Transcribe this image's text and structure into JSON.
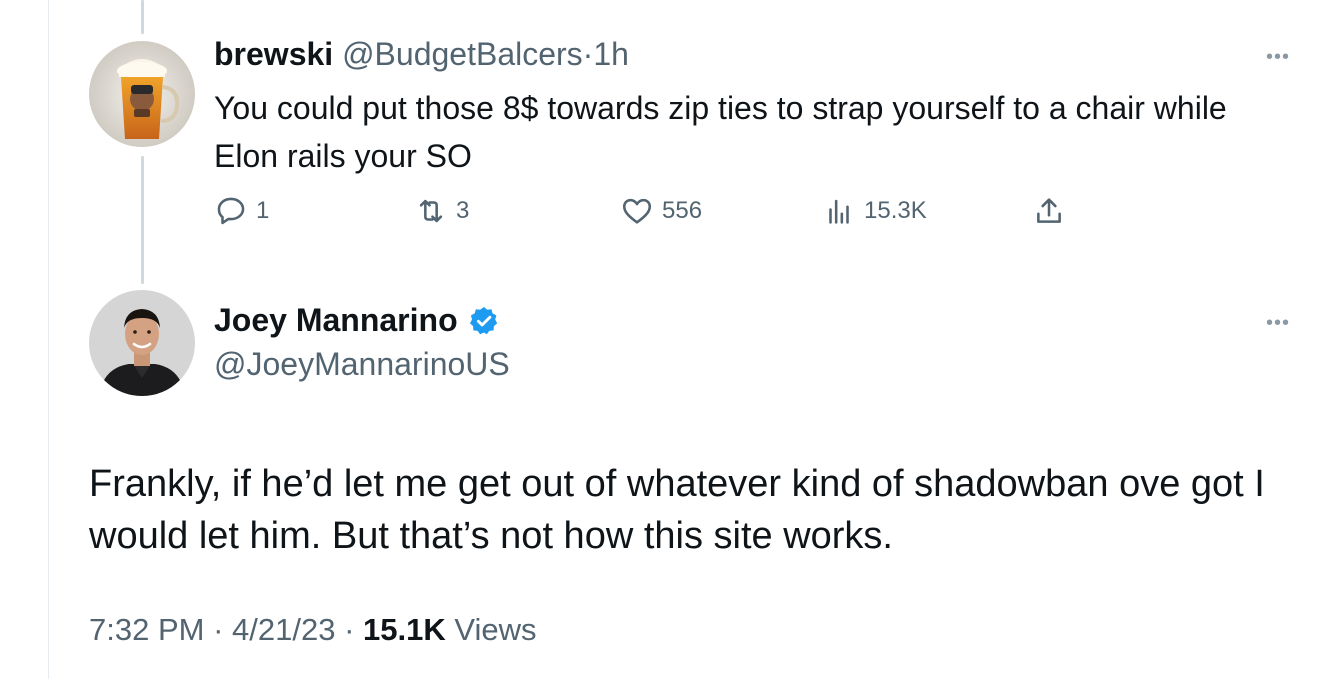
{
  "reply_tweet": {
    "display_name": "brewski",
    "handle": "@BudgetBalcers",
    "separator": "·",
    "time_ago": "1h",
    "text": "You could put those 8$ towards zip ties to strap yourself to a chair while Elon rails your SO",
    "avatar_icon": "beer-mug-avatar",
    "more_icon": "more-horizontal-icon",
    "actions": {
      "replies": "1",
      "retweets": "3",
      "likes": "556",
      "views": "15.3K"
    }
  },
  "main_tweet": {
    "display_name": "Joey Mannarino",
    "verified": true,
    "verified_color": "#1d9bf0",
    "handle": "@JoeyMannarinoUS",
    "avatar_icon": "profile-photo-avatar",
    "more_icon": "more-horizontal-icon",
    "text": "Frankly, if he’d let me get out of whatever kind of shadowban ove got I would let him. But that’s not how this site works.",
    "time": "7:32 PM",
    "separator": "·",
    "date": "4/21/23",
    "views_count": "15.1K",
    "views_label": "Views"
  },
  "colors": {
    "text_primary": "#0f1419",
    "text_secondary": "#536471",
    "thread_line": "#cfd9de",
    "verified_blue": "#1d9bf0"
  }
}
